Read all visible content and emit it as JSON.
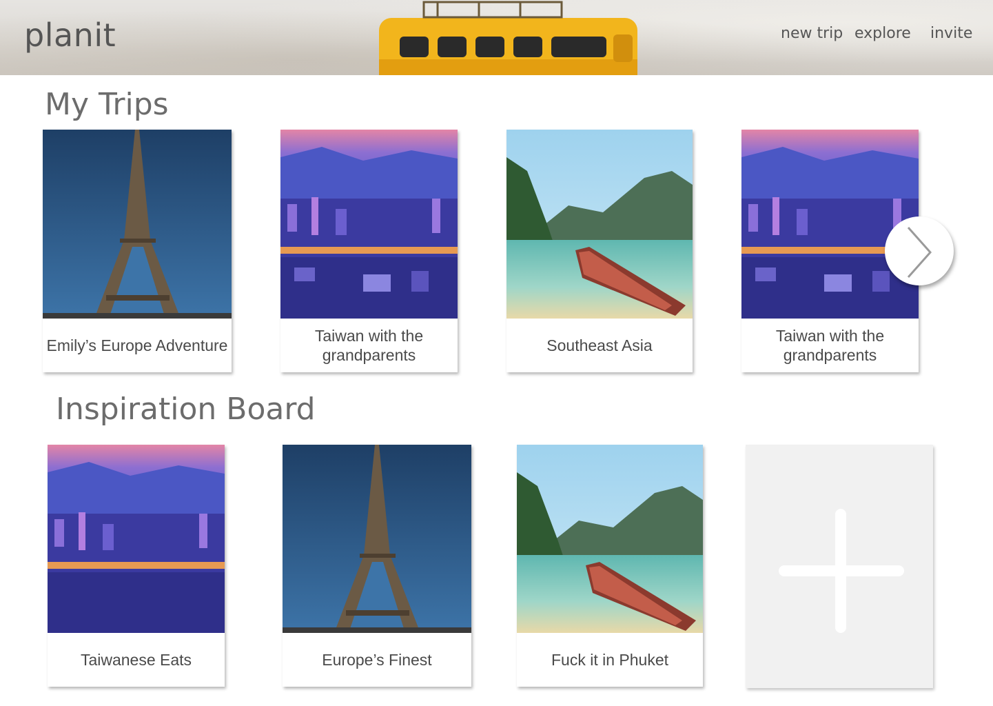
{
  "header": {
    "logo": "planit",
    "nav": {
      "new_trip": "new trip",
      "explore": "explore",
      "invite": "invite"
    }
  },
  "my_trips": {
    "title": "My Trips",
    "cards": [
      {
        "label": "Emily’s Europe Adventure",
        "image": "eiffel-tower"
      },
      {
        "label": "Taiwan with the grandparents",
        "image": "taipei-city"
      },
      {
        "label": "Southeast Asia",
        "image": "boat-lagoon"
      },
      {
        "label": "Taiwan with the grandparents",
        "image": "taipei-city"
      }
    ],
    "next_icon": "chevron-right-icon"
  },
  "inspiration": {
    "title": "Inspiration Board",
    "cards": [
      {
        "label": "Taiwanese Eats",
        "image": "taipei-city"
      },
      {
        "label": "Europe’s Finest",
        "image": "eiffel-tower"
      },
      {
        "label": "Fuck it in Phuket",
        "image": "boat-lagoon"
      }
    ],
    "add_icon": "plus-icon"
  },
  "colors": {
    "bus": "#f2b51c",
    "text": "#555555"
  }
}
